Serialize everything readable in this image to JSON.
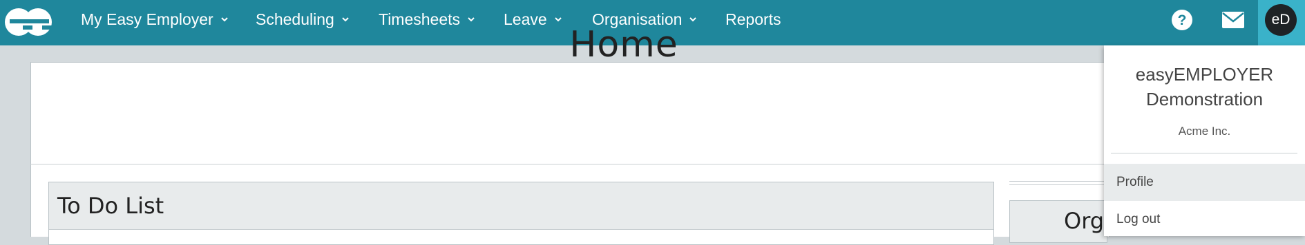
{
  "nav": {
    "logo_alt": "ee",
    "items": [
      {
        "label": "My Easy Employer",
        "has_menu": true
      },
      {
        "label": "Scheduling",
        "has_menu": true
      },
      {
        "label": "Timesheets",
        "has_menu": true
      },
      {
        "label": "Leave",
        "has_menu": true
      },
      {
        "label": "Organisation",
        "has_menu": true
      },
      {
        "label": "Reports",
        "has_menu": false
      }
    ],
    "help_icon": "help-circle-icon",
    "mail_icon": "mail-icon",
    "avatar_initials": "eD"
  },
  "page": {
    "title": "Home",
    "todo_title": "To Do List",
    "org_title_partial": "Org"
  },
  "user_menu": {
    "name": "easyEMPLOYER Demonstration",
    "company": "Acme Inc.",
    "items": [
      {
        "label": "Profile",
        "active": true
      },
      {
        "label": "Log out",
        "active": false
      }
    ]
  },
  "colors": {
    "nav_bg": "#1f879c",
    "avatar_bg": "#3ab2c9",
    "page_bg": "#d4dadd"
  }
}
